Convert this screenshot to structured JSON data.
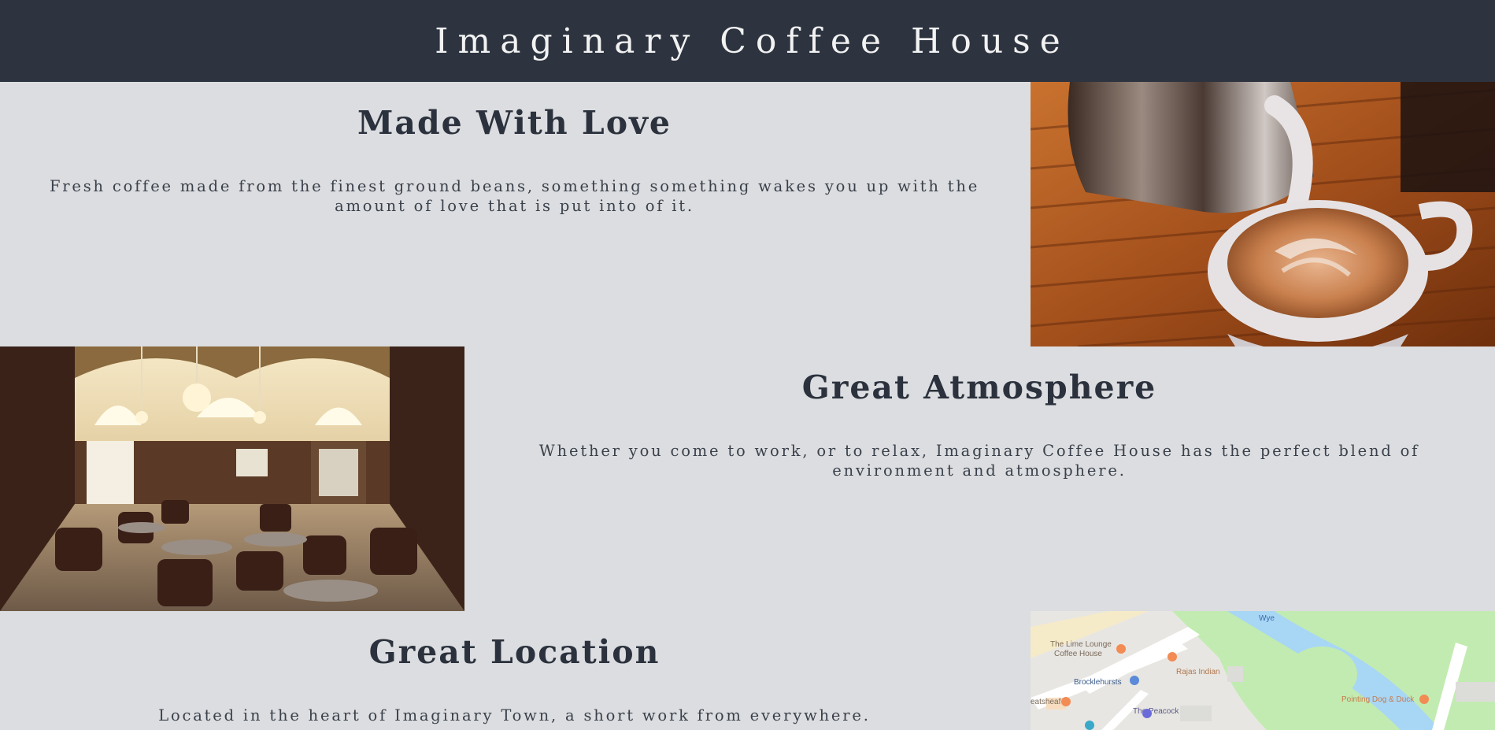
{
  "header": {
    "title": "Imaginary Coffee House"
  },
  "sections": [
    {
      "heading": "Made With Love",
      "body": "Fresh coffee made from the finest ground beans, something something wakes you up with the amount of love that is put into of it.",
      "image": "latte-art-photo"
    },
    {
      "heading": "Great Atmosphere",
      "body": "Whether you come to work, or to relax, Imaginary Coffee House has the perfect blend of environment and atmosphere.",
      "image": "cafe-interior-photo"
    },
    {
      "heading": "Great Location",
      "body": "Located in the heart of Imaginary Town, a short work from everywhere.",
      "image": "location-map"
    }
  ],
  "map": {
    "labels": {
      "lime_lounge_1": "The Lime Lounge",
      "lime_lounge_2": "Coffee House",
      "rajas": "Rajas Indian",
      "brocklehursts": "Brocklehursts",
      "peacock": "The Peacock",
      "pointing_dog": "Pointing Dog & Duck",
      "wye": "Wye",
      "wheatsheaf": "eatsheaf"
    }
  },
  "colors": {
    "header_bg": "#2d3440",
    "page_bg": "#dcdde0",
    "text": "#2b323d"
  }
}
